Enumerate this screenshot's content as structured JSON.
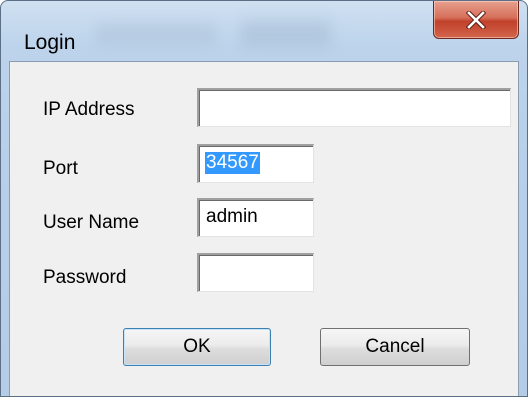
{
  "window": {
    "title": "Login",
    "close_icon": "close-icon"
  },
  "form": {
    "ip_address": {
      "label": "IP Address",
      "value": ""
    },
    "port": {
      "label": "Port",
      "value": "34567",
      "selected": true
    },
    "user_name": {
      "label": "User Name",
      "value": "admin"
    },
    "password": {
      "label": "Password",
      "value": ""
    }
  },
  "buttons": {
    "ok_label": "OK",
    "cancel_label": "Cancel"
  },
  "colors": {
    "title_gradient": "#bcd3eb",
    "close_button": "#c1412b",
    "client_background": "#f0f0f0",
    "selection": "#3399ff"
  }
}
